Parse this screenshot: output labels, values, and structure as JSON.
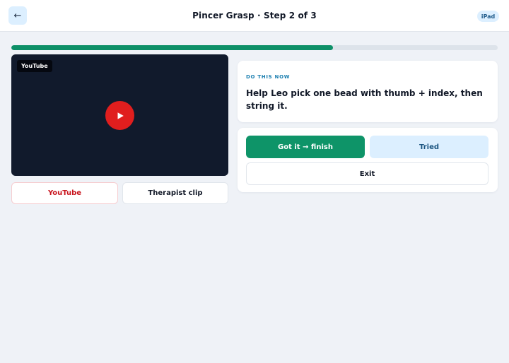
{
  "header": {
    "back_icon": "←",
    "title": "Pincer Grasp · Step 2 of 3",
    "device_badge": "iPad"
  },
  "progress": {
    "fraction": 0.661,
    "color": "#0e9068"
  },
  "video": {
    "source_tag": "YouTube",
    "play_icon": "play-icon",
    "play_color": "#e01e1e"
  },
  "source_buttons": {
    "youtube_label": "YouTube",
    "therapist_label": "Therapist clip"
  },
  "instruction": {
    "kicker": "DO THIS NOW",
    "text": "Help Leo pick one bead with thumb + index, then string it."
  },
  "actions": {
    "finish_label": "Got it → finish",
    "tried_label": "Tried",
    "exit_label": "Exit"
  },
  "colors": {
    "accent": "#0e9468",
    "soft_blue": "#dcefff",
    "youtube_red": "#c8141d"
  }
}
